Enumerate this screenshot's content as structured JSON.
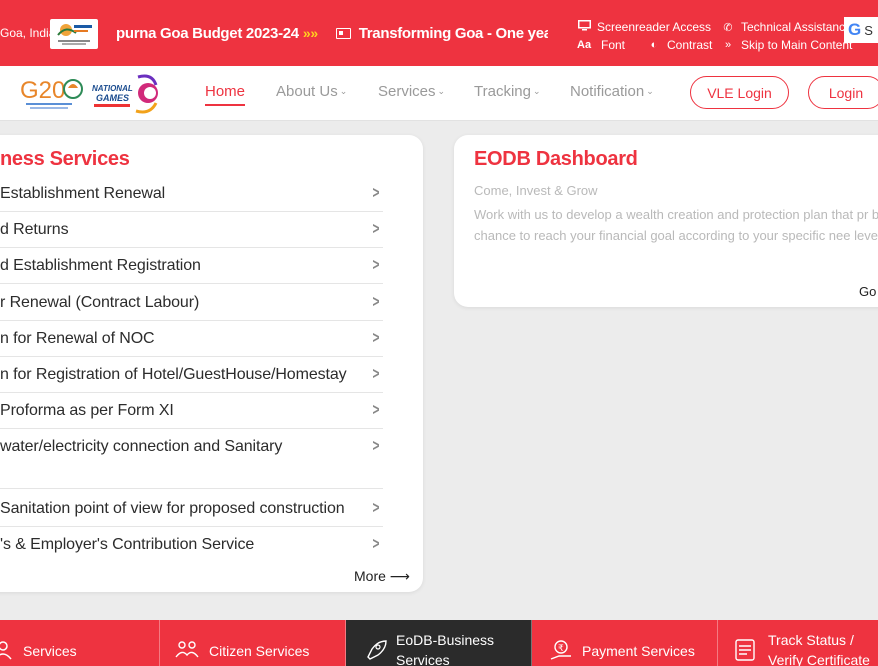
{
  "topbar": {
    "location": "Goa, India",
    "ticker": [
      "purna Goa Budget 2023-24",
      "Transforming Goa - One year of"
    ],
    "accessibility": {
      "screenreader": "Screenreader Access",
      "technical": "Technical Assistance",
      "font": "Font",
      "contrast": "Contrast",
      "skip": "Skip to Main Content"
    },
    "translate_label": "S"
  },
  "nav": {
    "items": [
      "Home",
      "About Us",
      "Services",
      "Tracking",
      "Notification"
    ],
    "vle_login": "VLE Login",
    "login": "Login",
    "g20_text": "G20",
    "games_text": "NATIONAL GAMES"
  },
  "services_card": {
    "title": "ness Services",
    "items": [
      "Establishment Renewal",
      "d Returns",
      "d Establishment Registration",
      "r Renewal (Contract Labour)",
      "n for Renewal of NOC",
      "n for Registration of Hotel/GuestHouse/Homestay",
      "Proforma as per Form XI",
      "water/electricity connection and Sanitary",
      "Sanitation point of view for proposed construction",
      "'s & Employer's Contribution Service"
    ],
    "more": "More"
  },
  "eodb_card": {
    "title": "EODB Dashboard",
    "subtitle": "Come, Invest & Grow",
    "description": "Work with us to develop a wealth creation and protection plan that pr best chance to reach your financial goal according to your specific nee level.",
    "go": "Go"
  },
  "bottom_tabs": {
    "services": "Services",
    "citizen": "Citizen Services",
    "eodb": "EoDB-Business",
    "eodb_line2": "Services",
    "payment": "Payment Services",
    "track": "Track Status /",
    "track_line2": "Verify Certificate"
  },
  "colors": {
    "brand_red": "#ee3340",
    "dark_tab": "#2b2b2b"
  }
}
